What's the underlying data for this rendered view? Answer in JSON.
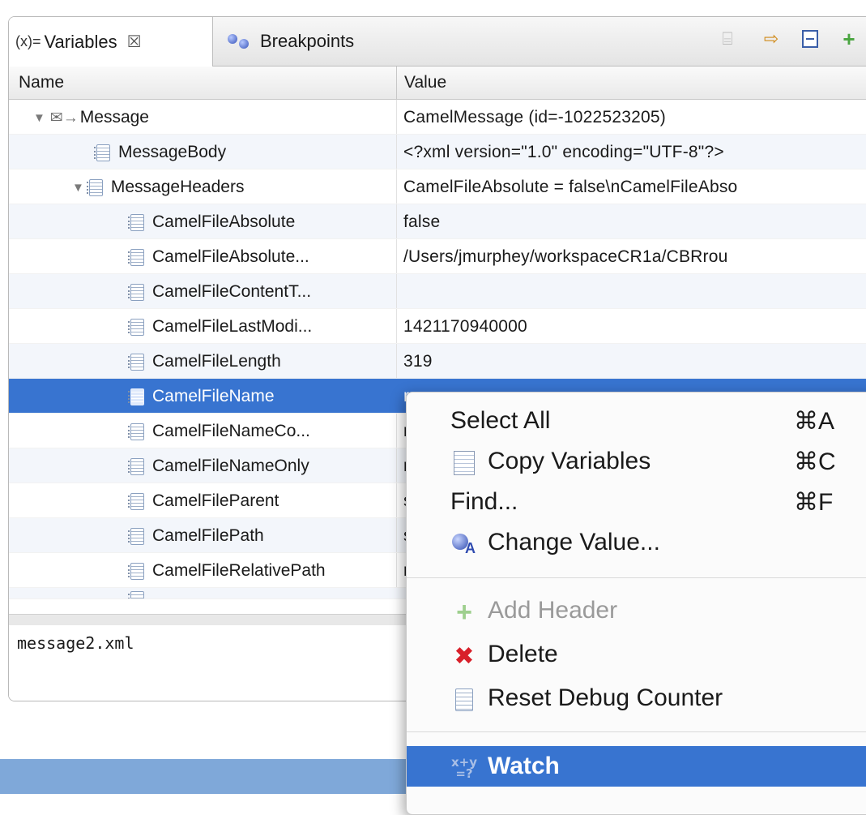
{
  "tabs": {
    "variables": {
      "prefix": "(x)=",
      "label": "Variables",
      "close": "☒"
    },
    "breakpoints": {
      "label": "Breakpoints"
    }
  },
  "toolbar": {
    "icons": [
      "show-logical-structure-icon",
      "select-next-icon",
      "collapse-all-icon",
      "add-icon"
    ]
  },
  "table": {
    "headers": {
      "name": "Name",
      "value": "Value"
    },
    "rows": [
      {
        "name": "Message",
        "value": "CamelMessage (id=-1022523205)",
        "expanded": true,
        "level": 0,
        "icon": "message-icon"
      },
      {
        "name": "MessageBody",
        "value": "<?xml version=\"1.0\" encoding=\"UTF-8\"?>",
        "level": 1,
        "icon": "variable-icon"
      },
      {
        "name": "MessageHeaders",
        "value": "CamelFileAbsolute = false\\nCamelFileAbso",
        "expanded": true,
        "level": 1,
        "icon": "variable-icon"
      },
      {
        "name": "CamelFileAbsolute",
        "value": "false",
        "level": 2,
        "icon": "variable-icon"
      },
      {
        "name": "CamelFileAbsolute...",
        "value": "/Users/jmurphey/workspaceCR1a/CBRrou",
        "level": 2,
        "icon": "variable-icon"
      },
      {
        "name": "CamelFileContentT...",
        "value": "",
        "level": 2,
        "icon": "variable-icon"
      },
      {
        "name": "CamelFileLastModi...",
        "value": "1421170940000",
        "level": 2,
        "icon": "variable-icon"
      },
      {
        "name": "CamelFileLength",
        "value": "319",
        "level": 2,
        "icon": "variable-icon"
      },
      {
        "name": "CamelFileName",
        "value": "r",
        "level": 2,
        "icon": "variable-icon",
        "selected": true
      },
      {
        "name": "CamelFileNameCo...",
        "value": "r",
        "level": 2,
        "icon": "variable-icon"
      },
      {
        "name": "CamelFileNameOnly",
        "value": "r",
        "level": 2,
        "icon": "variable-icon"
      },
      {
        "name": "CamelFileParent",
        "value": "s",
        "level": 2,
        "icon": "variable-icon"
      },
      {
        "name": "CamelFilePath",
        "value": "s",
        "level": 2,
        "icon": "variable-icon"
      },
      {
        "name": "CamelFileRelativePath",
        "value": "r",
        "level": 2,
        "icon": "variable-icon"
      }
    ]
  },
  "detail": {
    "text": "message2.xml"
  },
  "context_menu": {
    "items": [
      {
        "label": "Select All",
        "shortcut": "⌘A"
      },
      {
        "label": "Copy Variables",
        "shortcut": "⌘C",
        "icon": "copy-icon"
      },
      {
        "label": "Find...",
        "shortcut": "⌘F"
      },
      {
        "label": "Change Value...",
        "icon": "change-value-icon"
      },
      {
        "label": "Add Header",
        "icon": "add-icon",
        "disabled": true
      },
      {
        "label": "Delete",
        "icon": "delete-icon"
      },
      {
        "label": "Reset Debug Counter",
        "icon": "variable-icon"
      },
      {
        "label": "Watch",
        "icon": "watch-icon",
        "highlighted": true
      }
    ],
    "watch_icon_text": "x+y\n=?"
  },
  "colors": {
    "selection": "#3874d0",
    "accent_strip": "#7fa8d9",
    "delete": "#d8202a",
    "add": "#9ecf8e"
  }
}
